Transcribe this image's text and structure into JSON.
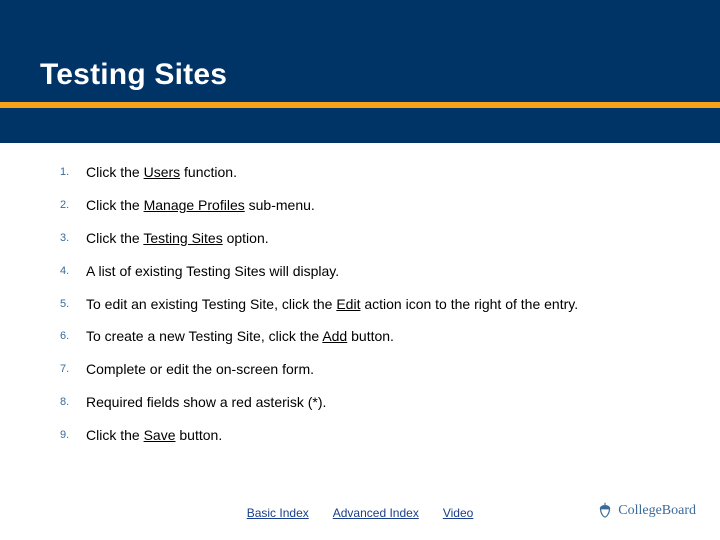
{
  "header": {
    "title": "Testing Sites"
  },
  "steps": [
    {
      "n": "1.",
      "parts": [
        "Click the ",
        {
          "u": "Users"
        },
        " function."
      ]
    },
    {
      "n": "2.",
      "parts": [
        "Click the ",
        {
          "u": "Manage Profiles"
        },
        " sub-menu."
      ]
    },
    {
      "n": "3.",
      "parts": [
        "Click the ",
        {
          "u": "Testing Sites"
        },
        " option."
      ]
    },
    {
      "n": "4.",
      "parts": [
        "A list of existing Testing Sites will display."
      ]
    },
    {
      "n": "5.",
      "parts": [
        "To edit an existing Testing Site, click the ",
        {
          "u": "Edit"
        },
        " action icon to the right of the entry."
      ]
    },
    {
      "n": "6.",
      "parts": [
        "To create a new Testing Site, click the ",
        {
          "u": "Add"
        },
        " button."
      ]
    },
    {
      "n": "7.",
      "parts": [
        "Complete or edit the on-screen form."
      ]
    },
    {
      "n": "8.",
      "parts": [
        "Required fields show a red asterisk (*)."
      ]
    },
    {
      "n": "9.",
      "parts": [
        "Click the ",
        {
          "u": "Save"
        },
        " button."
      ]
    }
  ],
  "footer": {
    "links": [
      "Basic Index",
      "Advanced Index",
      "Video"
    ],
    "logo_text": "CollegeBoard"
  }
}
